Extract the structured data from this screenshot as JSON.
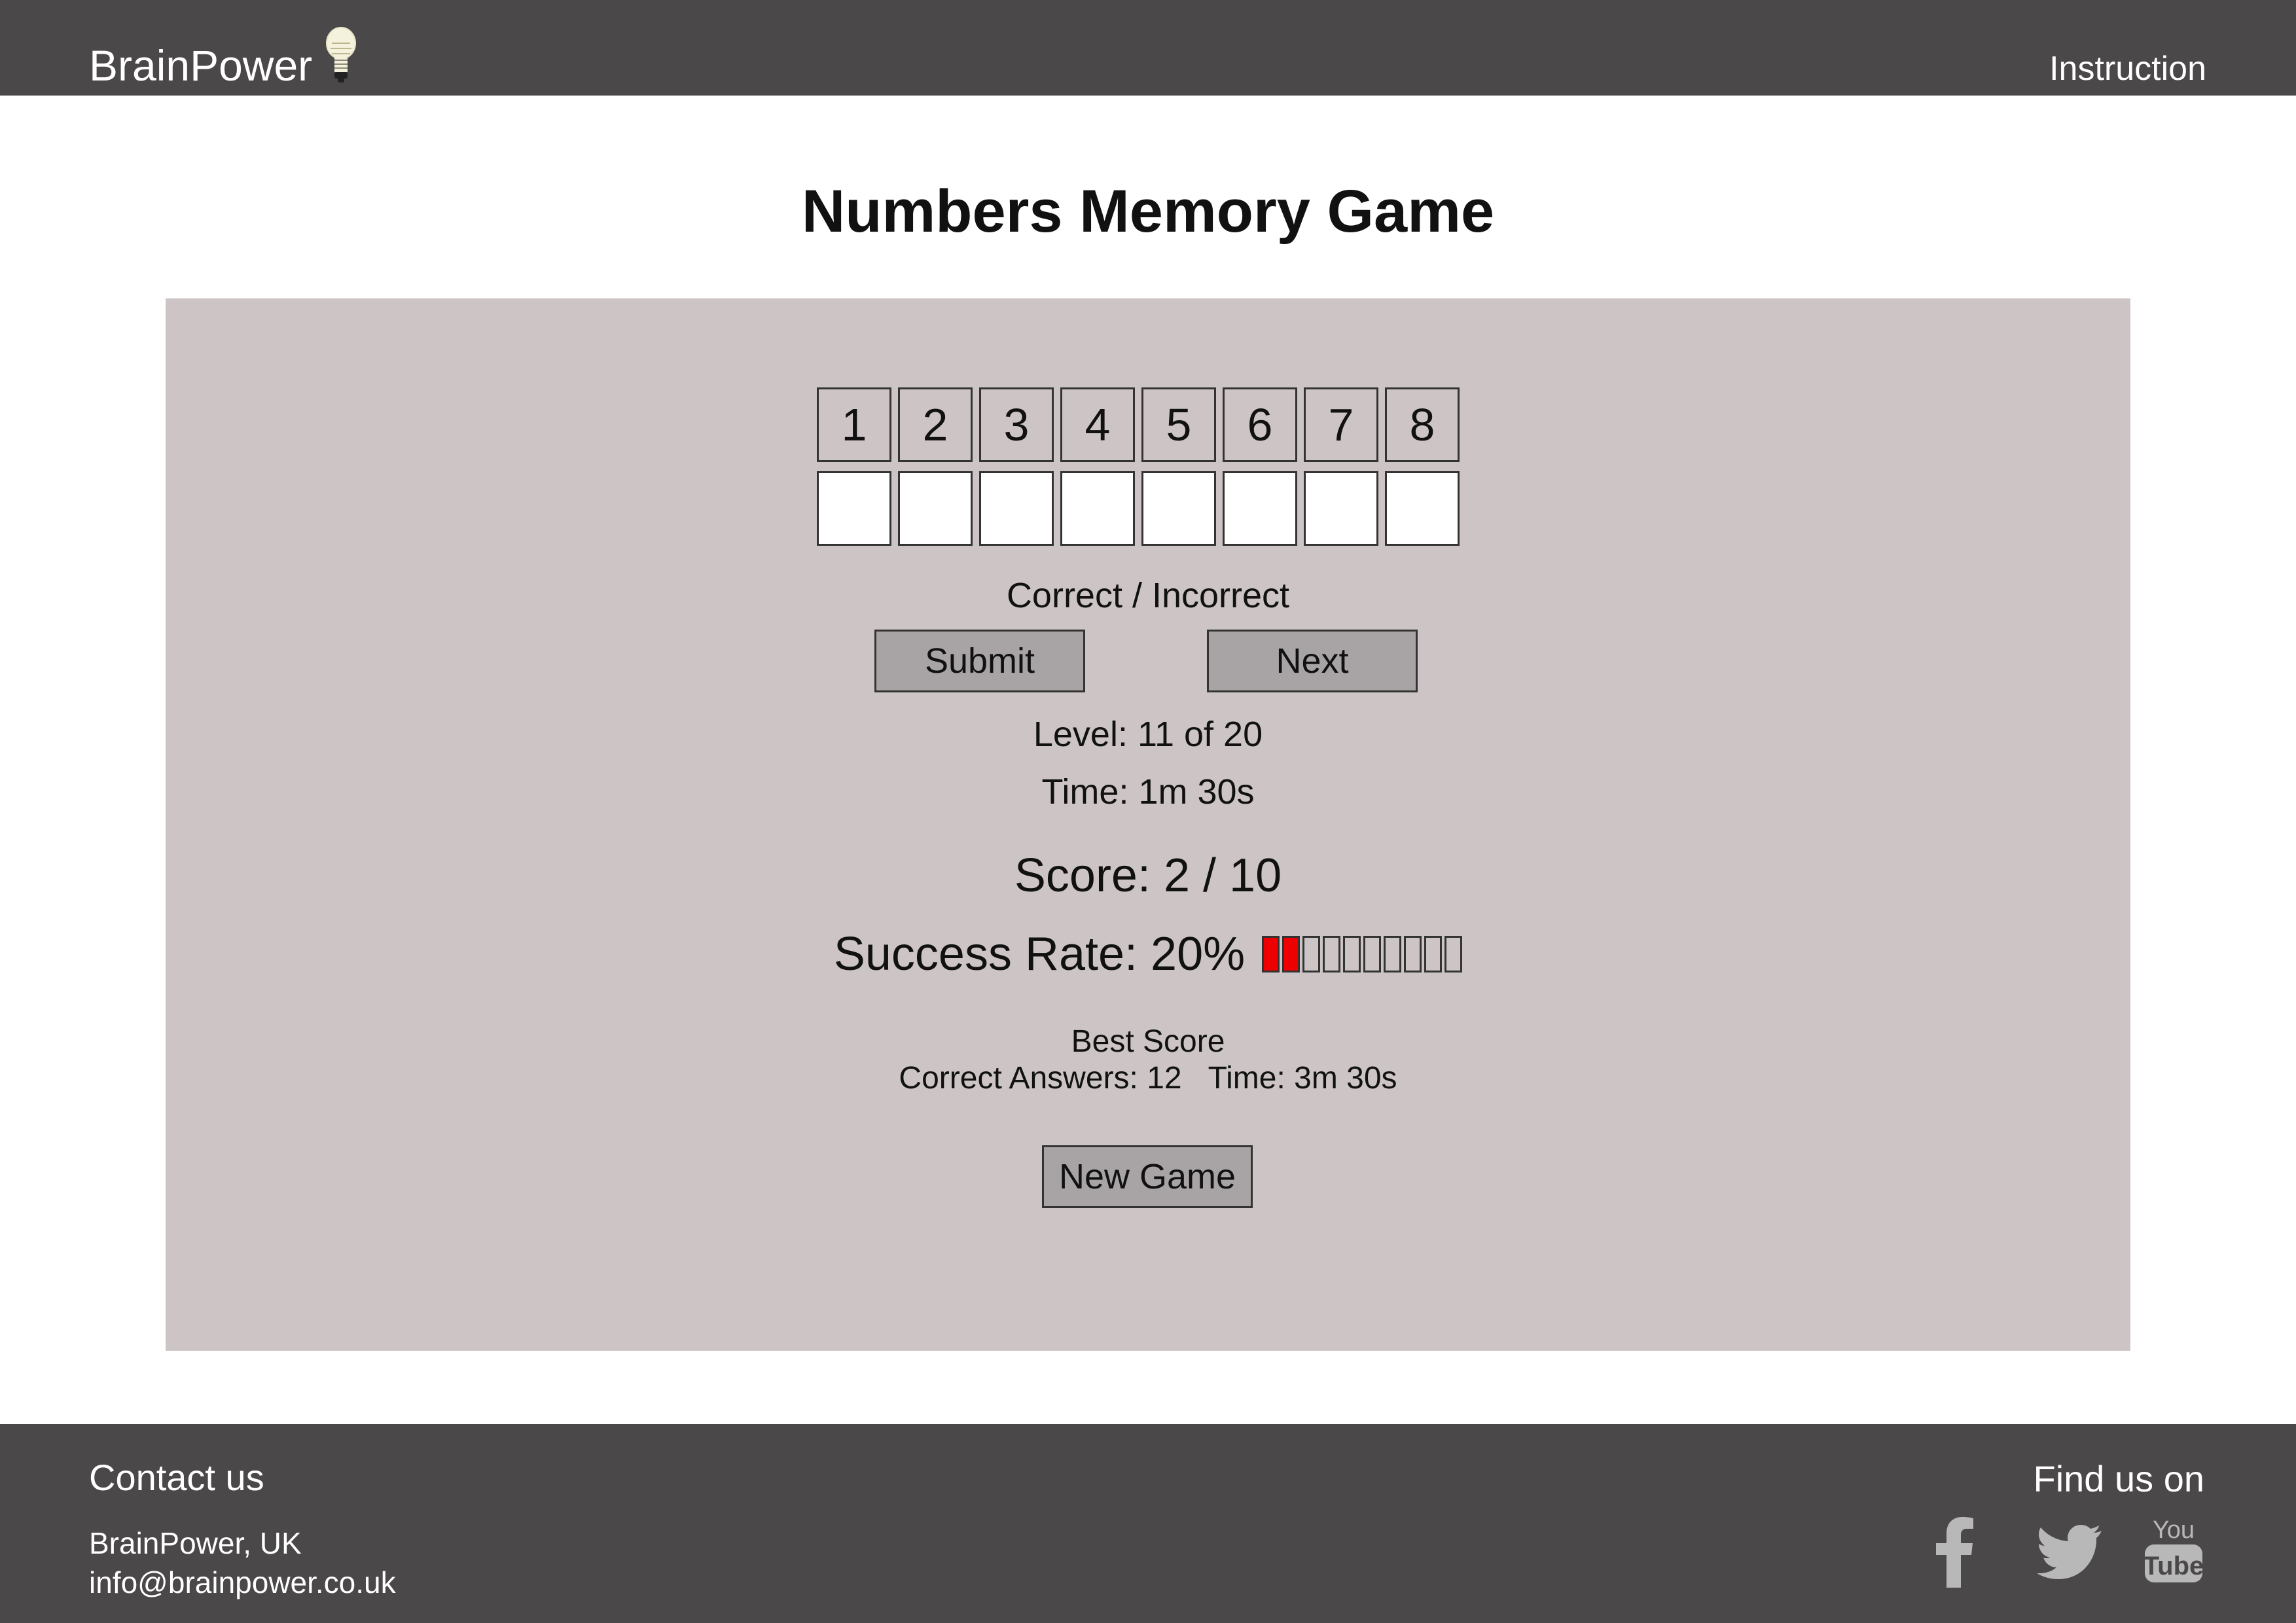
{
  "header": {
    "brand": "BrainPower",
    "instruction_link": "Instruction"
  },
  "page": {
    "title": "Numbers Memory Game"
  },
  "game": {
    "digits": [
      "1",
      "2",
      "3",
      "4",
      "5",
      "6",
      "7",
      "8"
    ],
    "answers": [
      "",
      "",
      "",
      "",
      "",
      "",
      "",
      ""
    ],
    "feedback": "Correct / Incorrect",
    "submit_label": "Submit",
    "next_label": "Next",
    "level": "Level: 11 of 20",
    "time": "Time: 1m 30s",
    "score": "Score: 2 / 10",
    "success_rate_label": "Success Rate: 20%",
    "success_rate_fraction": 0.2,
    "success_rate_segments": 10,
    "best_score_title": "Best Score",
    "best_correct": "Correct Answers: 12",
    "best_time": "Time: 3m 30s",
    "new_game_label": "New Game"
  },
  "footer": {
    "contact_title": "Contact us",
    "company": "BrainPower, UK",
    "email": "info@brainpower.co.uk",
    "find_title": "Find us on",
    "social": [
      "facebook-icon",
      "twitter-icon",
      "youtube-icon"
    ]
  },
  "colors": {
    "header_bg": "#4b4849",
    "panel_bg": "#cdc5c5",
    "button_bg": "#a8a4a5",
    "progress_fill": "#ee0000",
    "icon_gray": "#b8b8b8"
  }
}
